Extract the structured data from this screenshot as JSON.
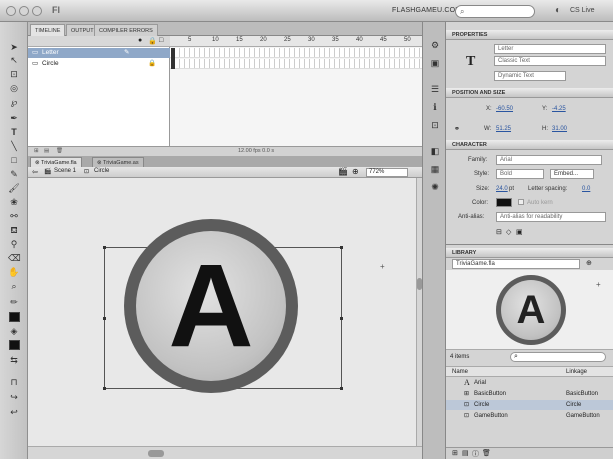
{
  "window": {
    "brand": "FLASHGAMEU.COM",
    "search_placeholder": "",
    "cs_live": "CS Live"
  },
  "timeline": {
    "tabs": [
      "TIMELINE",
      "OUTPUT",
      "COMPILER ERRORS"
    ],
    "layers": [
      {
        "name": "Letter"
      },
      {
        "name": "Circle"
      }
    ],
    "frame_numbers": [
      "5",
      "10",
      "15",
      "20",
      "25",
      "30",
      "35",
      "40",
      "45",
      "50"
    ],
    "status": "12.00 fps  0.0 s"
  },
  "document": {
    "tabs": [
      "TriviaGame.fla",
      "TriviaGame.as"
    ],
    "scene": "Scene 1",
    "symbol": "Circle",
    "zoom": "772%",
    "glyph": "A"
  },
  "properties": {
    "header": "PROPERTIES",
    "instance_name": "Letter",
    "text_engine": "Classic Text",
    "text_type": "Dynamic Text",
    "position_size": {
      "header": "POSITION AND SIZE",
      "x_label": "X:",
      "x": "-60.50",
      "y_label": "Y:",
      "y": "-4.25",
      "w_label": "W:",
      "w": "51.25",
      "h_label": "H:",
      "h": "31.00"
    },
    "character": {
      "header": "CHARACTER",
      "family_label": "Family:",
      "family": "Arial",
      "style_label": "Style:",
      "style": "Bold",
      "embed": "Embed...",
      "size_label": "Size:",
      "size": "24.0",
      "size_unit": "pt",
      "spacing_label": "Letter spacing:",
      "spacing": "0.0",
      "color_label": "Color:",
      "auto_kern": "Auto kern",
      "antialias_label": "Anti-alias:",
      "antialias": "Anti-alias for readability"
    }
  },
  "library": {
    "header": "LIBRARY",
    "file": "TriviaGame.fla",
    "count": "4 items",
    "col_name": "Name",
    "col_linkage": "Linkage",
    "preview_glyph": "A",
    "items": [
      {
        "name": "Arial",
        "linkage": ""
      },
      {
        "name": "BasicButton",
        "linkage": "BasicButton"
      },
      {
        "name": "Circle",
        "linkage": "Circle"
      },
      {
        "name": "GameButton",
        "linkage": "GameButton"
      }
    ]
  },
  "colors": {
    "stroke_swatch": "#111111",
    "fill_swatch": "#111111",
    "circle_ring": "#5c5c5c",
    "selected_layer": "#8fa8c8"
  }
}
